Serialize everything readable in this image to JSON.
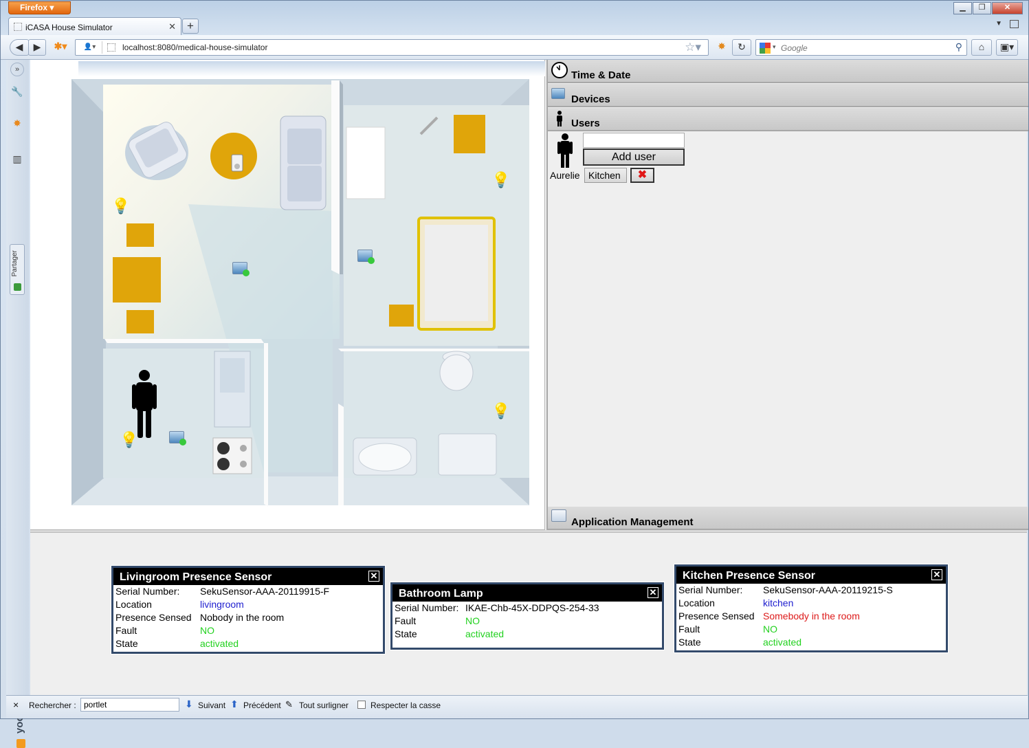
{
  "browser": {
    "app_button": "Firefox",
    "tab_title": "iCASA House Simulator",
    "url": "localhost:8080/medical-house-simulator",
    "search_placeholder": "Google"
  },
  "panel": {
    "sections": {
      "time": "Time & Date",
      "devices": "Devices",
      "users": "Users",
      "apps": "Application Management"
    },
    "add_user_label": "Add user",
    "add_user_value": "",
    "users": [
      {
        "name": "Aurelie",
        "location": "Kitchen"
      }
    ]
  },
  "popups": [
    {
      "title": "Livingroom Presence Sensor",
      "rows": [
        {
          "key": "Serial Number:",
          "value": "SekuSensor-AAA-20119915-F"
        },
        {
          "key": "Location",
          "value": "livingroom",
          "color": "#1e1ecf"
        },
        {
          "key": "Presence Sensed",
          "value": "Nobody in the room"
        },
        {
          "key": "Fault",
          "value": "NO",
          "color": "#22d11f"
        },
        {
          "key": "State",
          "value": "activated",
          "color": "#22d11f"
        }
      ]
    },
    {
      "title": "Bathroom Lamp",
      "rows": [
        {
          "key": "Serial Number:",
          "value": "IKAE-Chb-45X-DDPQS-254-33"
        },
        {
          "key": "Fault",
          "value": "NO",
          "color": "#22d11f"
        },
        {
          "key": "State",
          "value": "activated",
          "color": "#22d11f"
        }
      ]
    },
    {
      "title": "Kitchen Presence Sensor",
      "rows": [
        {
          "key": "Serial Number:",
          "value": "SekuSensor-AAA-20119215-S"
        },
        {
          "key": "Location",
          "value": "kitchen",
          "color": "#1e1ecf"
        },
        {
          "key": "Presence Sensed",
          "value": "Somebody in the room",
          "color": "#dd1a1a"
        },
        {
          "key": "Fault",
          "value": "NO",
          "color": "#22d11f"
        },
        {
          "key": "State",
          "value": "activated",
          "color": "#22d11f"
        }
      ]
    }
  ],
  "findbar": {
    "close": "×",
    "label": "Rechercher :",
    "query": "portlet",
    "next": "Suivant",
    "prev": "Précédent",
    "highlight": "Tout surligner",
    "match_case": "Respecter la casse"
  },
  "sidebar": {
    "share": "Partager",
    "brand": "yoono"
  },
  "icons": {
    "back": "back-arrow-icon",
    "forward": "forward-arrow-icon",
    "reload": "reload-icon",
    "home": "home-icon",
    "star": "star-icon",
    "search": "magnifier-icon",
    "clock": "clock-icon",
    "device": "device-icon",
    "user": "person-icon",
    "lamp": "lightbulb-icon",
    "delete": "red-x-icon"
  },
  "colors": {
    "firefox_orange": "#e2660e",
    "popup_border": "#334a6b",
    "status_green": "#22d11f",
    "location_blue": "#1e1ecf",
    "alert_red": "#dd1a1a"
  }
}
